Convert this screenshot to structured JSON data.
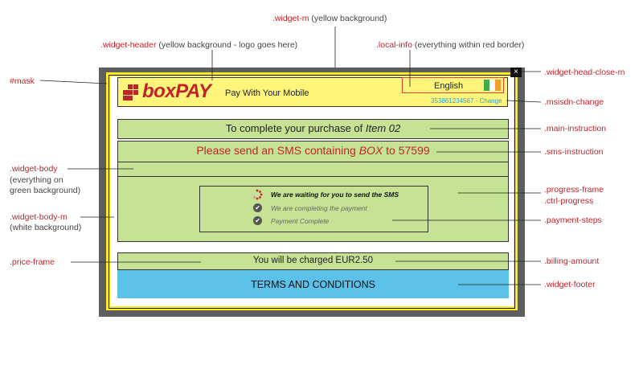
{
  "widget": {
    "logo_text": "boxPAY",
    "tagline": "Pay With Your Mobile",
    "language": "English",
    "msisdn_text": "353861234567 - Change",
    "close_glyph": "×",
    "main_instruction_prefix": "To complete your purchase of ",
    "main_instruction_item": "Item 02",
    "sms_instruction_prefix": "Please send an SMS containing ",
    "sms_instruction_keyword": "BOX",
    "sms_instruction_suffix": " to 57599",
    "steps": [
      "We are waiting for you to send the SMS",
      "We are completing the payment",
      "Payment Complete"
    ],
    "billing_text": "You will be charged EUR2.50",
    "footer_text": "TERMS AND CONDITIONS"
  },
  "annotations": {
    "widget_m": {
      "cls": ".widget-m",
      "note": " (yellow background)"
    },
    "widget_header": {
      "cls": ".widget-header",
      "note": " (yellow background - logo goes here)"
    },
    "local_info": {
      "cls": ".local-info",
      "note": " (everything within red border)"
    },
    "mask": {
      "cls": "#mask"
    },
    "close_m": {
      "cls": ".widget-head-close-m"
    },
    "msisdn_change": {
      "cls": ".msisdn-change"
    },
    "main_instruction": {
      "cls": ".main-instruction"
    },
    "sms_instruction": {
      "cls": ".sms-instruction"
    },
    "widget_body": {
      "cls": ".widget-body",
      "note": "(everything on green background)"
    },
    "progress_frame": {
      "cls": ".progress-frame"
    },
    "ctrl_progress": {
      "cls": ".ctrl-progress"
    },
    "widget_body_m": {
      "cls": ".widget-body-m",
      "note": "(white background)"
    },
    "payment_steps": {
      "cls": ".payment-steps"
    },
    "price_frame": {
      "cls": ".price-frame"
    },
    "billing_amount": {
      "cls": ".billing-amount"
    },
    "widget_footer": {
      "cls": ".widget-footer"
    }
  },
  "colors": {
    "annotation_red": "#c0242b",
    "mask_gray": "#5e5e5e",
    "widget_yellow": "#ffec1f",
    "header_yellow": "#fff57a",
    "body_green": "#c6e295",
    "footer_blue": "#5cc1e8",
    "link_blue": "#2aa3d6"
  }
}
